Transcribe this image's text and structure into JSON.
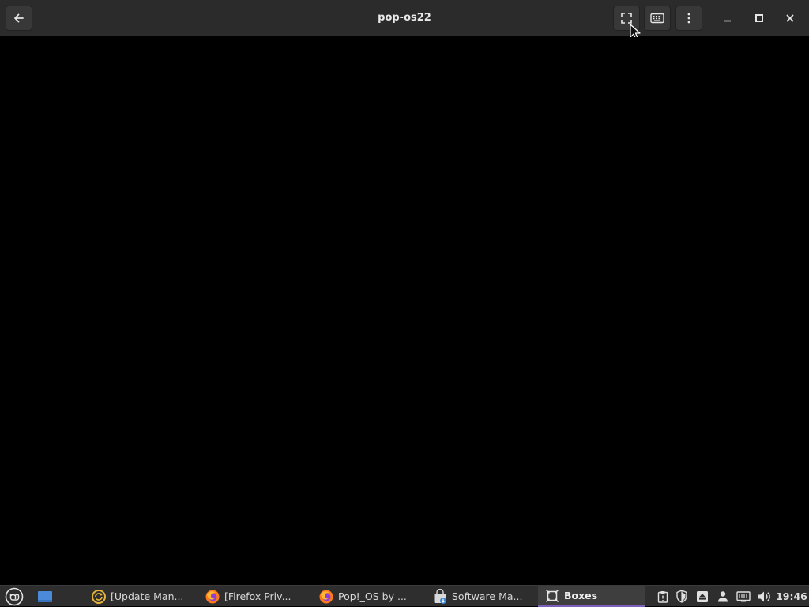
{
  "window": {
    "title": "pop-os22"
  },
  "headerbar": {
    "buttons": [
      "back-icon",
      "fullscreen-icon",
      "keyboard-icon",
      "more-options-icon"
    ],
    "window_controls": [
      "minimize-icon",
      "maximize-icon",
      "close-icon"
    ]
  },
  "taskbar": {
    "tasks": [
      {
        "label": "[Update Man...",
        "icon": "update-manager-icon",
        "active": false
      },
      {
        "label": "[Firefox Priv...",
        "icon": "firefox-icon",
        "active": false
      },
      {
        "label": "Pop!_OS by ...",
        "icon": "firefox-icon",
        "active": false
      },
      {
        "label": "Software Ma...",
        "icon": "software-manager-icon",
        "active": false
      },
      {
        "label": "Boxes",
        "icon": "boxes-icon",
        "active": true
      }
    ],
    "tray_icons": [
      "clipboard-icon",
      "shield-icon",
      "eject-icon",
      "user-icon",
      "network-icon",
      "volume-icon"
    ],
    "clock": "19:46"
  },
  "colors": {
    "headerbar": "#2b2b2b",
    "taskbar": "#2e2e2e",
    "active_task_indicator": "#7c5fb8",
    "vm_display": "#000000"
  }
}
